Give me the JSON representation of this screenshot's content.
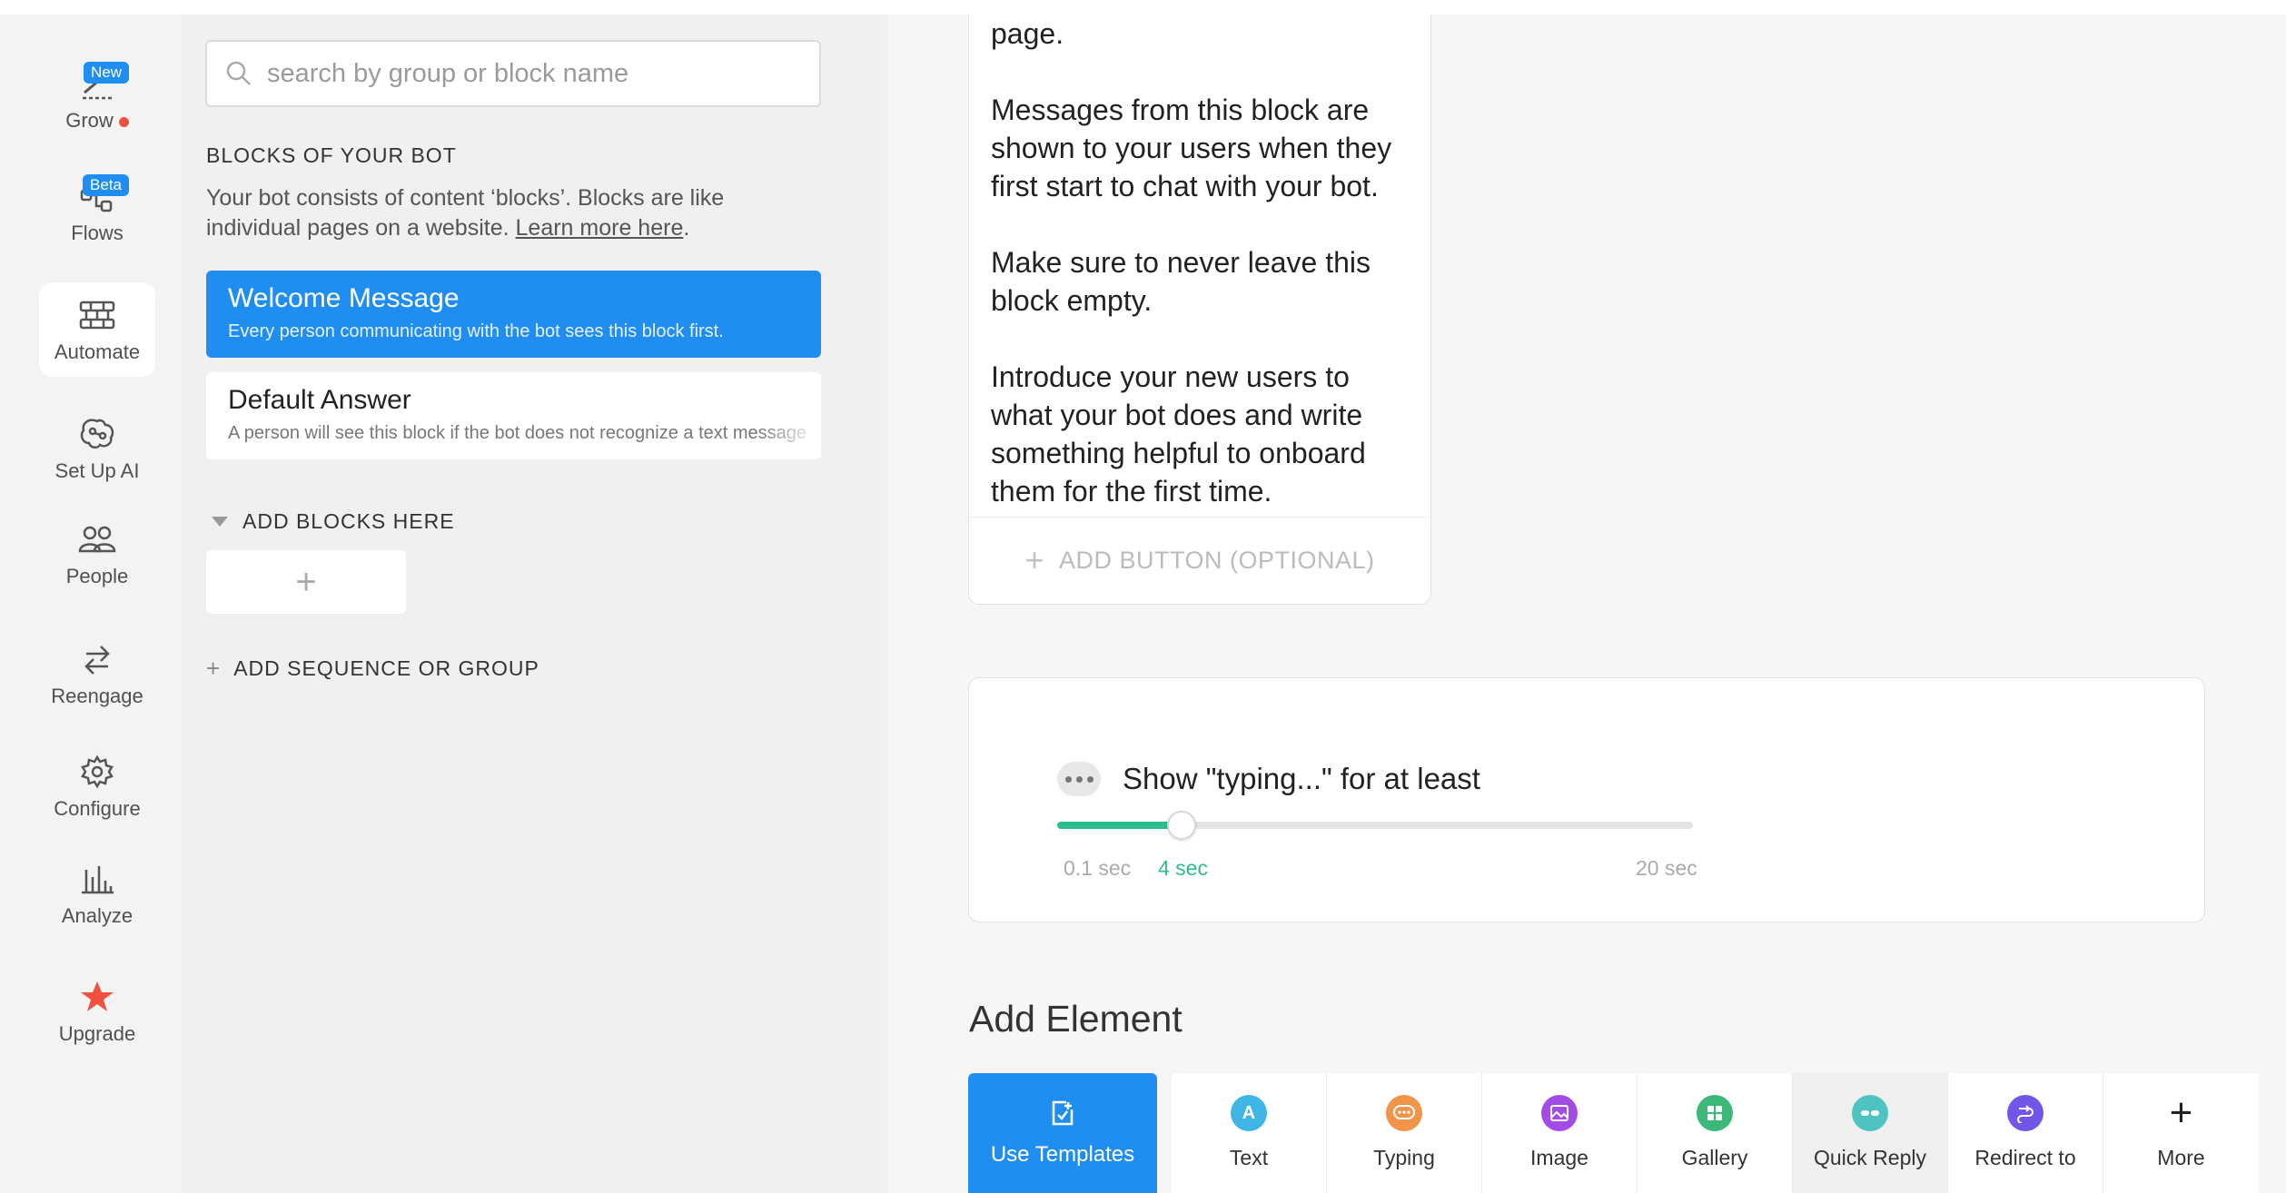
{
  "nav": {
    "items": [
      {
        "label": "Grow",
        "badge": "New"
      },
      {
        "label": "Flows",
        "badge": "Beta"
      },
      {
        "label": "Automate"
      },
      {
        "label": "Set Up AI"
      },
      {
        "label": "People"
      },
      {
        "label": "Reengage"
      },
      {
        "label": "Configure"
      },
      {
        "label": "Analyze"
      },
      {
        "label": "Upgrade"
      }
    ],
    "active": "Automate"
  },
  "blocks_panel": {
    "search_placeholder": "search by group or block name",
    "section_title": "BLOCKS OF YOUR BOT",
    "description": "Your bot consists of content ‘blocks’. Blocks are like individual pages on a website.",
    "learn_more": "Learn more here",
    "blocks": [
      {
        "title": "Welcome Message",
        "subtitle": "Every person communicating with the bot sees this block first."
      },
      {
        "title": "Default Answer",
        "subtitle": "A person will see this block if the bot does not recognize a text message"
      }
    ],
    "add_blocks_title": "ADD BLOCKS HERE",
    "add_block_symbol": "+",
    "add_sequence": "ADD SEQUENCE OR GROUP"
  },
  "text_card": {
    "paragraphs": [
      "page.",
      "Messages from this block are shown to your users when they first start to chat with your bot.",
      "Make sure to never leave this block empty.",
      "Introduce your new users to what your bot does and write something helpful to onboard them for the first time."
    ],
    "add_button": "ADD BUTTON (OPTIONAL)"
  },
  "typing": {
    "title": "Show \"typing...\" for at least",
    "min_label": "0.1 sec",
    "max_label": "20 sec",
    "value_label": "4 sec",
    "min": 0.1,
    "max": 20,
    "value": 4
  },
  "add_element": {
    "title": "Add Element",
    "templates_label": "Use Templates",
    "elements": [
      {
        "label": "Text",
        "icon": "text-icon",
        "color": "#3fb6e6"
      },
      {
        "label": "Typing",
        "icon": "typing-icon",
        "color": "#f0954a"
      },
      {
        "label": "Image",
        "icon": "image-icon",
        "color": "#a24be6"
      },
      {
        "label": "Gallery",
        "icon": "gallery-icon",
        "color": "#3cb878"
      },
      {
        "label": "Quick Reply",
        "icon": "quick-reply-icon",
        "color": "#4fc3c1"
      },
      {
        "label": "Redirect to",
        "icon": "redirect-icon",
        "color": "#7256e8"
      },
      {
        "label": "More",
        "icon": "plus-icon"
      }
    ]
  },
  "colors": {
    "accent": "#208ef0",
    "slider": "#2fbc8c",
    "upgrade_star": "#f2503f"
  }
}
